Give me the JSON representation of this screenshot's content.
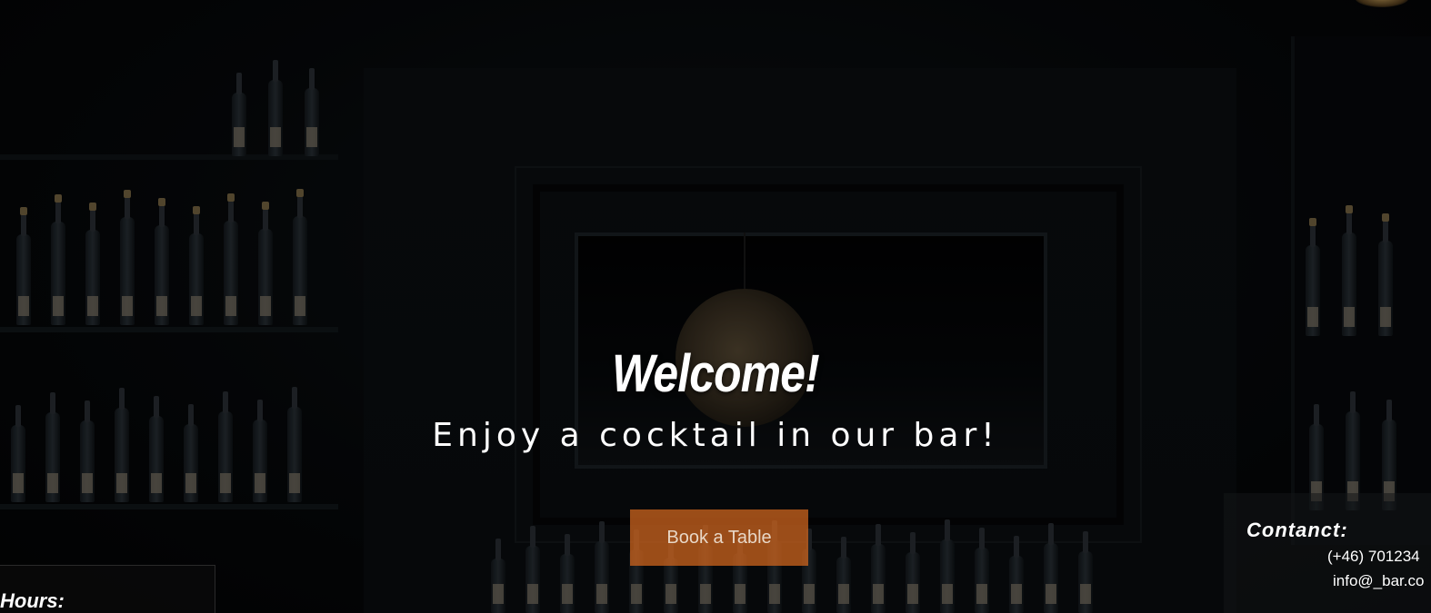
{
  "hero": {
    "heading": "Welcome!",
    "tagline": "Enjoy a cocktail in our bar!",
    "cta_label": "Book a Table"
  },
  "contact": {
    "title": "Contanct:",
    "phone": "(+46) 701234",
    "email": "info@_bar.co"
  },
  "hours": {
    "title": "Hours:"
  },
  "colors": {
    "accent": "#d6681e",
    "background": "#050607",
    "text": "#ffffff"
  }
}
